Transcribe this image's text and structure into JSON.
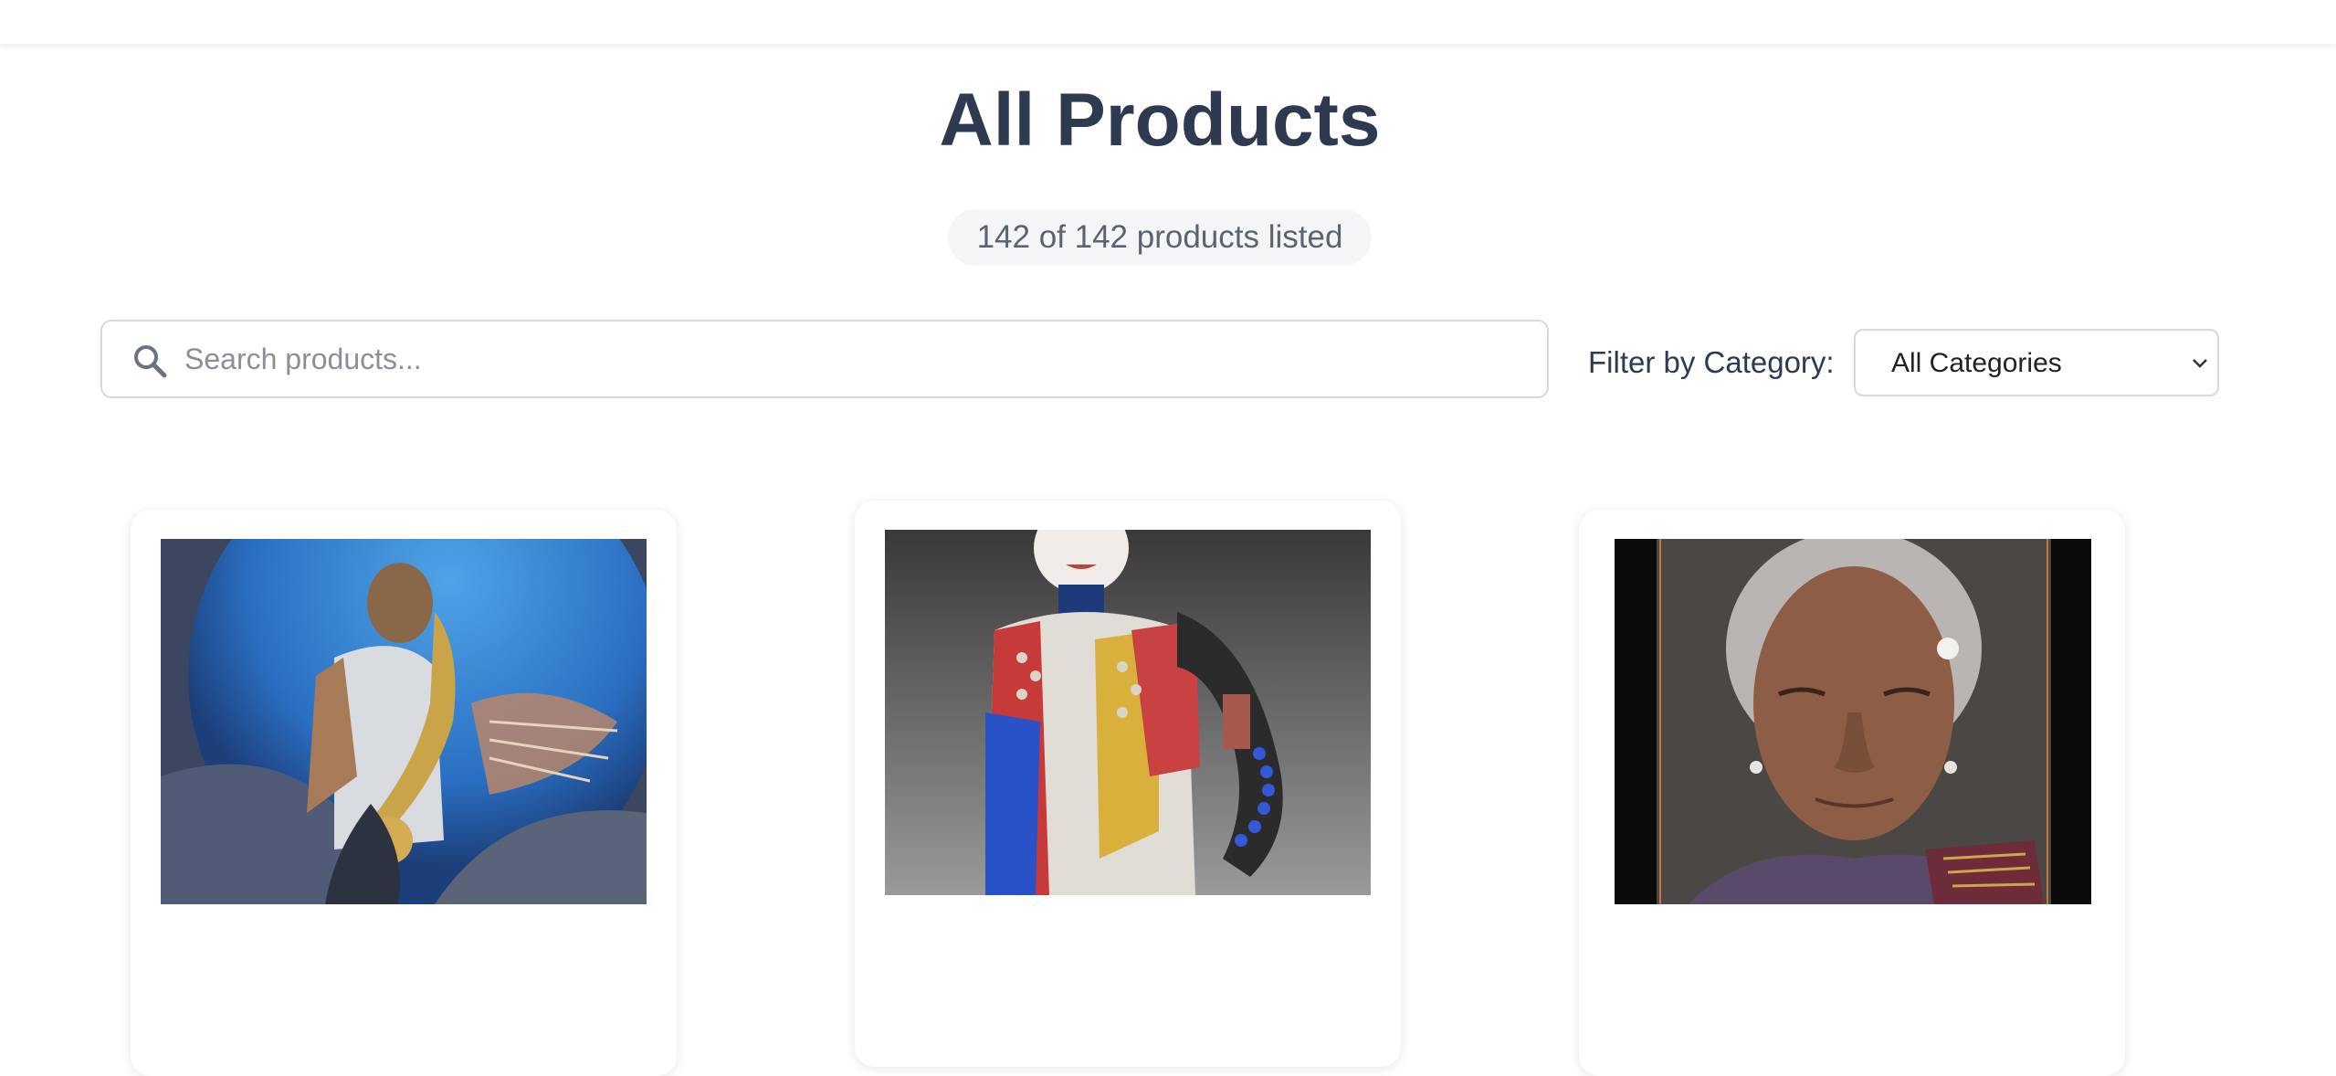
{
  "header": {
    "title": "All Products",
    "count_text": "142 of 142 products listed"
  },
  "search": {
    "placeholder": "Search products...",
    "value": ""
  },
  "filter": {
    "label": "Filter by Category:",
    "selected": "All Categories"
  },
  "products": [
    {
      "image": "saxophone-player-painting"
    },
    {
      "image": "beaded-figure-sculpture"
    },
    {
      "image": "elderly-woman-portrait"
    }
  ],
  "colors": {
    "title": "#2d3a4f",
    "badge_bg": "#f4f5f7",
    "border": "#d6d9de"
  }
}
